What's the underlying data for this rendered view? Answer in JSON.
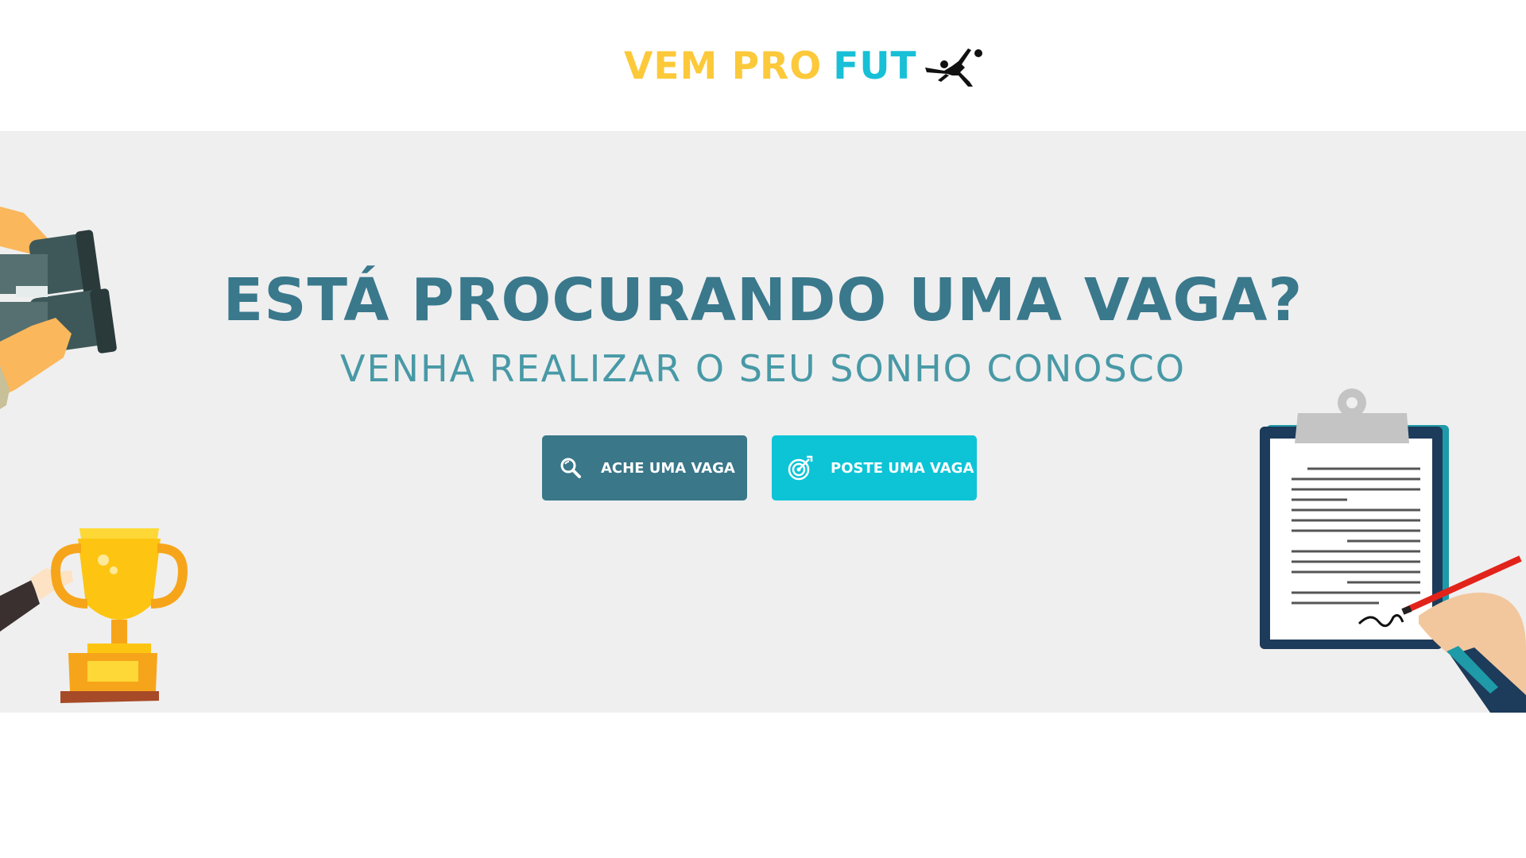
{
  "header": {
    "logo_part1": "VEM PRO",
    "logo_part2": "FUT",
    "logo_icon": "bicycle-kick-player-icon",
    "colors": {
      "part1": "#fcc93a",
      "part2": "#17c0d6"
    }
  },
  "hero": {
    "headline": "ESTÁ PROCURANDO UMA VAGA?",
    "subheadline": "VENHA REALIZAR O SEU SONHO CONOSCO",
    "background": "#efefef",
    "buttons": [
      {
        "label": "ACHE UMA VAGA",
        "icon": "search-icon",
        "color": "#397789"
      },
      {
        "label": "POSTE UMA VAGA",
        "icon": "target-icon",
        "color": "#0cc4d6"
      }
    ],
    "illustrations": [
      "binoculars",
      "trophy",
      "clipboard-contract"
    ]
  }
}
